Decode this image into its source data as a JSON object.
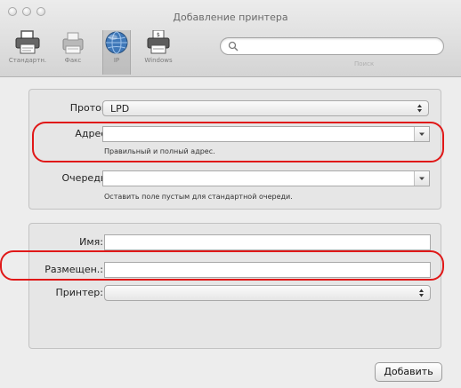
{
  "window": {
    "title": "Добавление принтера"
  },
  "toolbar": {
    "items": [
      {
        "label": "Стандартн.",
        "icon": "printer-icon"
      },
      {
        "label": "Факс",
        "icon": "fax-icon"
      },
      {
        "label": "IP",
        "icon": "globe-icon",
        "selected": true
      },
      {
        "label": "Windows",
        "icon": "windows-printer-icon"
      }
    ],
    "search_placeholder": "",
    "search_label": "Поиск"
  },
  "connection": {
    "protocol_label": "Протокол:",
    "protocol_value": "LPD",
    "address_label": "Адрес:",
    "address_value": "",
    "address_hint": "Правильный и полный адрес.",
    "queue_label": "Очередь:",
    "queue_value": "",
    "queue_hint": "Оставить поле пустым для стандартной очереди."
  },
  "details": {
    "name_label": "Имя:",
    "name_value": "",
    "location_label": "Размещен.:",
    "location_value": "",
    "printer_label": "Принтер:",
    "printer_value": ""
  },
  "actions": {
    "add_label": "Добавить"
  },
  "colors": {
    "highlight_oval": "#e01818",
    "window_bg": "#ededed"
  }
}
